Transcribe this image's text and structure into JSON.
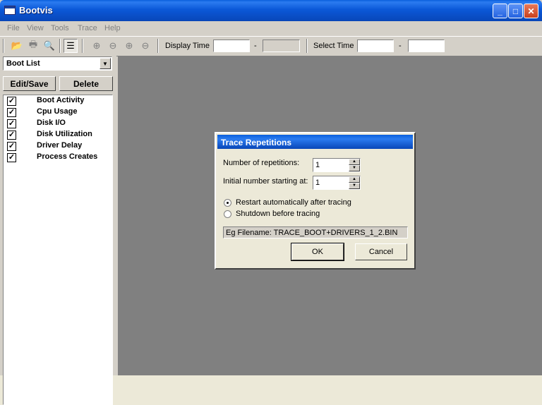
{
  "window": {
    "title": "Bootvis"
  },
  "titlebar_buttons": {
    "minimize": "_",
    "maximize": "□",
    "close": "✕"
  },
  "menu": [
    "File",
    "View",
    "Tools",
    "Trace",
    "Help"
  ],
  "toolbar": {
    "display_time_label": "Display Time",
    "display_time_start": "",
    "display_time_end": "",
    "dash": "-",
    "select_time_label": "Select Time",
    "select_time_start": "",
    "select_time_end": ""
  },
  "left_panel": {
    "combo_value": "Boot List",
    "edit_save_label": "Edit/Save",
    "delete_label": "Delete",
    "items": [
      {
        "label": "Boot Activity",
        "checked": true
      },
      {
        "label": "Cpu Usage",
        "checked": true
      },
      {
        "label": "Disk I/O",
        "checked": true
      },
      {
        "label": "Disk Utilization",
        "checked": true
      },
      {
        "label": "Driver Delay",
        "checked": true
      },
      {
        "label": "Process Creates",
        "checked": true
      }
    ]
  },
  "dialog": {
    "title": "Trace Repetitions",
    "repetitions_label": "Number of repetitions:",
    "repetitions_value": "1",
    "initial_label": "Initial number starting at:",
    "initial_value": "1",
    "radio_restart": "Restart automatically after tracing",
    "radio_shutdown": "Shutdown before tracing",
    "selected_radio": "restart",
    "filename_example": "Eg Filename: TRACE_BOOT+DRIVERS_1_2.BIN",
    "ok_label": "OK",
    "cancel_label": "Cancel"
  },
  "colors": {
    "titlebar": "#0846b8",
    "workspace": "#808080",
    "face": "#d4d0c8"
  }
}
